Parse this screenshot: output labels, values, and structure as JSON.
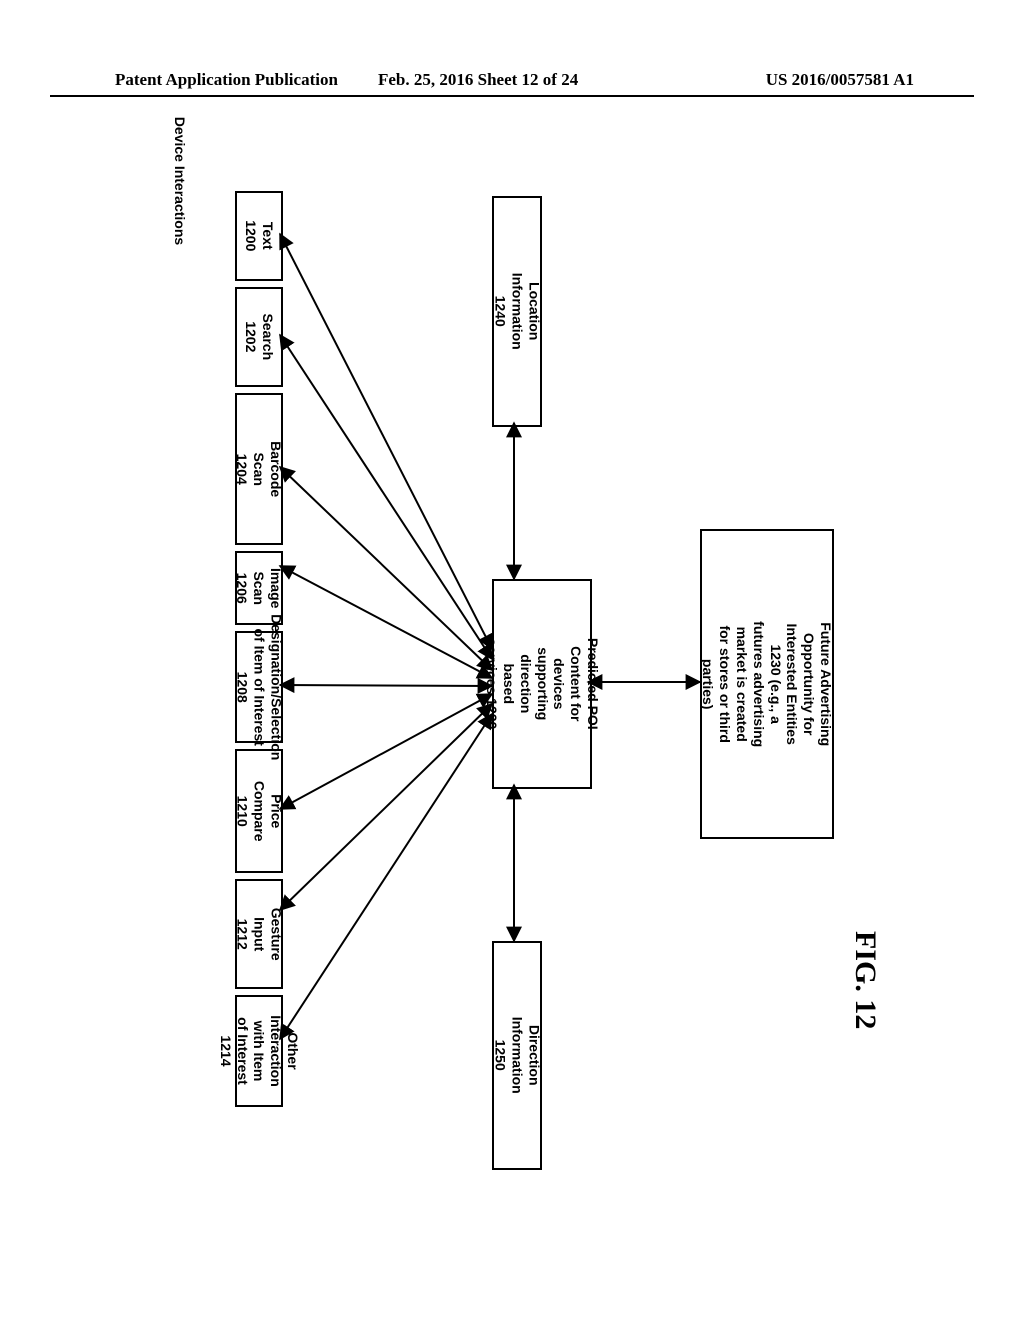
{
  "header": {
    "left": "Patent Application Publication",
    "center": "Feb. 25, 2016  Sheet 12 of 24",
    "right": "US 2016/0057581 A1"
  },
  "fig_label": "FIG. 12",
  "section_title": "Device Interactions",
  "interactions": [
    "Text 1200",
    "Search 1202",
    "Barcode Scan 1204",
    "Image Scan 1206",
    "Designation/Selection of Item of Interest 1208",
    "Price Compare 1210",
    "Gesture Input 1212",
    "Other Interaction with Item of Interest 1214"
  ],
  "center_box": "Predicted POI Content for devices supporting direction based services 1220",
  "right_box": "Future Advertising Opportunity for Interested Entities 1230 (e.g., a futures advertising market is created for stores or third parties)",
  "top_box": "Location Information 1240",
  "bottom_box": "Direction Information 1250"
}
